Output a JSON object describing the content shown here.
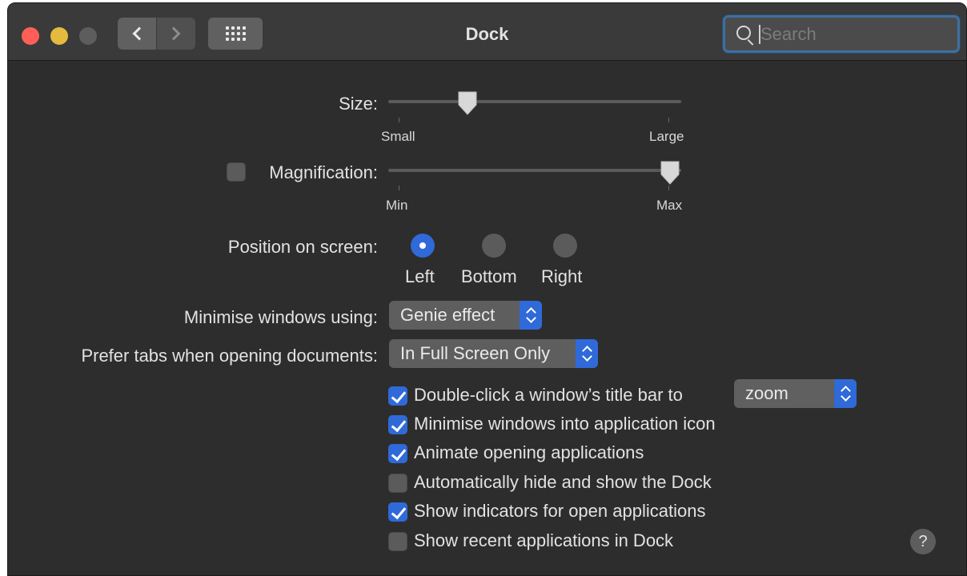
{
  "window": {
    "title": "Dock",
    "search": {
      "placeholder": "Search",
      "value": ""
    }
  },
  "size": {
    "label": "Size:",
    "min_label": "Small",
    "max_label": "Large",
    "value_fraction": 0.25
  },
  "magnification": {
    "label": "Magnification:",
    "checked": false,
    "min_label": "Min",
    "max_label": "Max",
    "value_fraction": 1.0
  },
  "position": {
    "label": "Position on screen:",
    "options": [
      "Left",
      "Bottom",
      "Right"
    ],
    "selected": "Left"
  },
  "minimise_using": {
    "label": "Minimise windows using:",
    "value": "Genie effect"
  },
  "prefer_tabs": {
    "label": "Prefer tabs when opening documents:",
    "value": "In Full Screen Only"
  },
  "options": {
    "double_click": {
      "label": "Double-click a window’s title bar to",
      "checked": true,
      "action": "zoom"
    },
    "minimise_into_icon": {
      "label": "Minimise windows into application icon",
      "checked": true
    },
    "animate": {
      "label": "Animate opening applications",
      "checked": true
    },
    "autohide": {
      "label": "Automatically hide and show the Dock",
      "checked": false
    },
    "indicators": {
      "label": "Show indicators for open applications",
      "checked": true
    },
    "recent": {
      "label": "Show recent applications in Dock",
      "checked": false
    }
  },
  "help": {
    "label": "?"
  },
  "colors": {
    "accent": "#2f6ad8",
    "background": "#2d2d2d",
    "titlebar": "#3a3a3a"
  }
}
